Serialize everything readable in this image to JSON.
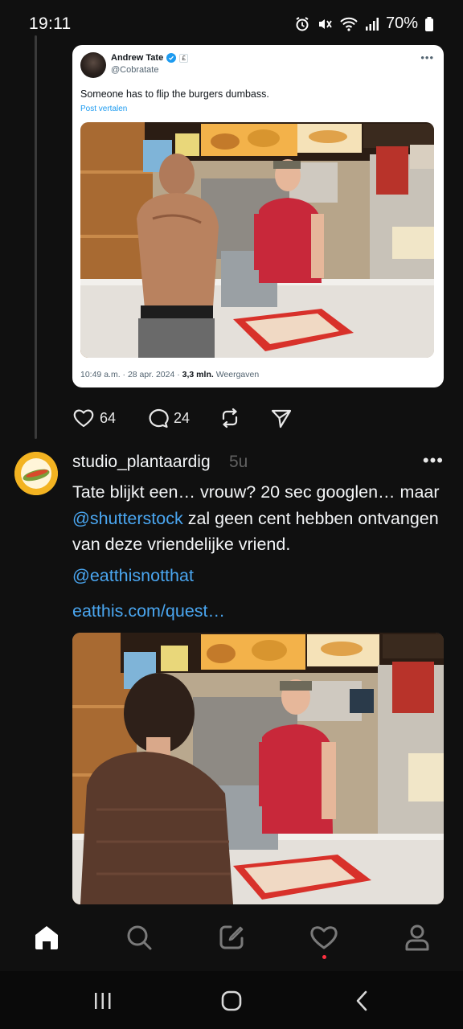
{
  "status_bar": {
    "time": "19:11",
    "battery": "70%"
  },
  "tweet": {
    "author_name": "Andrew Tate",
    "author_handle": "@Cobratate",
    "text": "Someone has to flip the burgers dumbass.",
    "translate_label": "Post vertalen",
    "meta_time": "10:49 a.m. · 28 apr. 2024 · ",
    "meta_views_count": "3,3 mln.",
    "meta_views_label": " Weergaven",
    "photo_description_icon": "photo-icon"
  },
  "actions": {
    "likes": "64",
    "replies": "24"
  },
  "post2": {
    "username": "studio_plantaardig",
    "time": "5u",
    "body_part1": "Tate blijkt een… vrouw? 20 sec googlen… maar ",
    "body_link": "@shutterstock",
    "body_part2": " zal geen cent hebben ontvangen van deze vriendelijke vriend.",
    "mention": "@eatthisnotthat",
    "url": "eatthis.com/quest…"
  },
  "colors": {
    "background": "#101010",
    "link": "#4aa6f0",
    "notification_dot": "#ff3040",
    "verified": "#1d9bf0"
  },
  "icons": {
    "bottom_nav": [
      "home-icon",
      "search-icon",
      "compose-icon",
      "activity-heart-icon",
      "profile-icon"
    ],
    "system_nav": [
      "recents-icon",
      "home-circle-icon",
      "back-icon"
    ]
  }
}
